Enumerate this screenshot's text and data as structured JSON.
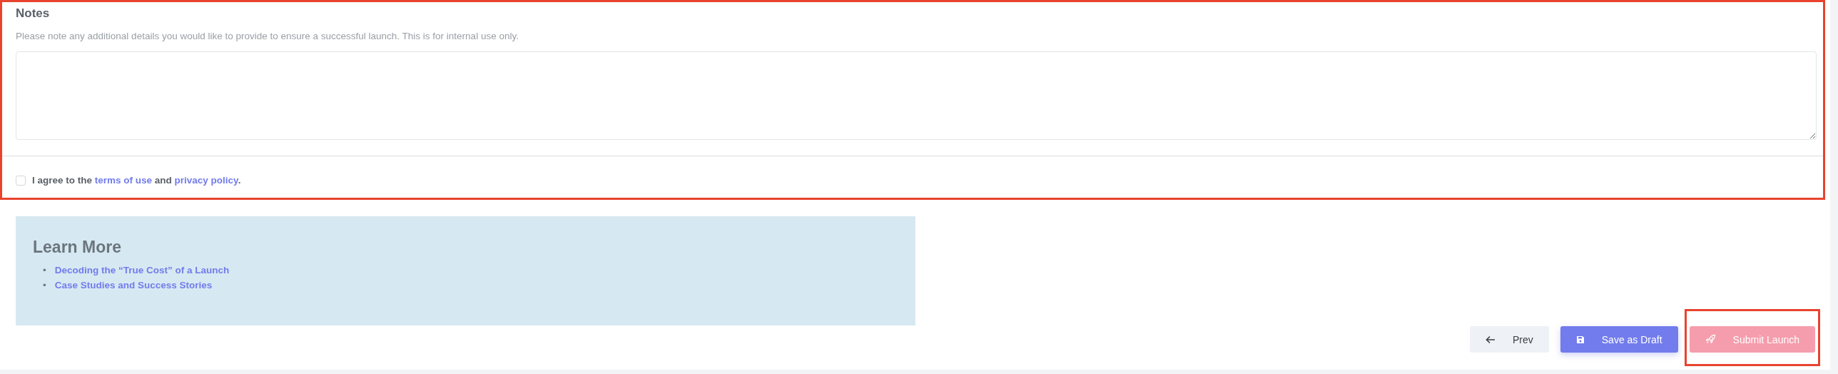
{
  "notes_section": {
    "highlighted": true,
    "title": "Notes",
    "description": "Please note any additional details you would like to provide to ensure a successful launch. This is for internal use only.",
    "agreement": {
      "checked": false,
      "text_before": "I agree to the",
      "terms_link": "terms of use",
      "text_middle": "and",
      "privacy_link": "privacy policy",
      "text_after": "."
    }
  },
  "learn_more": {
    "title": "Learn More",
    "links": [
      {
        "bullet": "•",
        "text": "Decoding the “True Cost” of a Launch"
      },
      {
        "bullet": "•",
        "text": "Case Studies and Success Stories"
      }
    ]
  },
  "buttons": [
    {
      "kind": "prev",
      "label": "Prev",
      "disabled": false,
      "highlighted": false
    },
    {
      "kind": "draft",
      "label": "Save as Draft",
      "disabled": false,
      "highlighted": false
    },
    {
      "kind": "submit",
      "label": "Submit Launch",
      "disabled": true,
      "highlighted": true
    }
  ]
}
